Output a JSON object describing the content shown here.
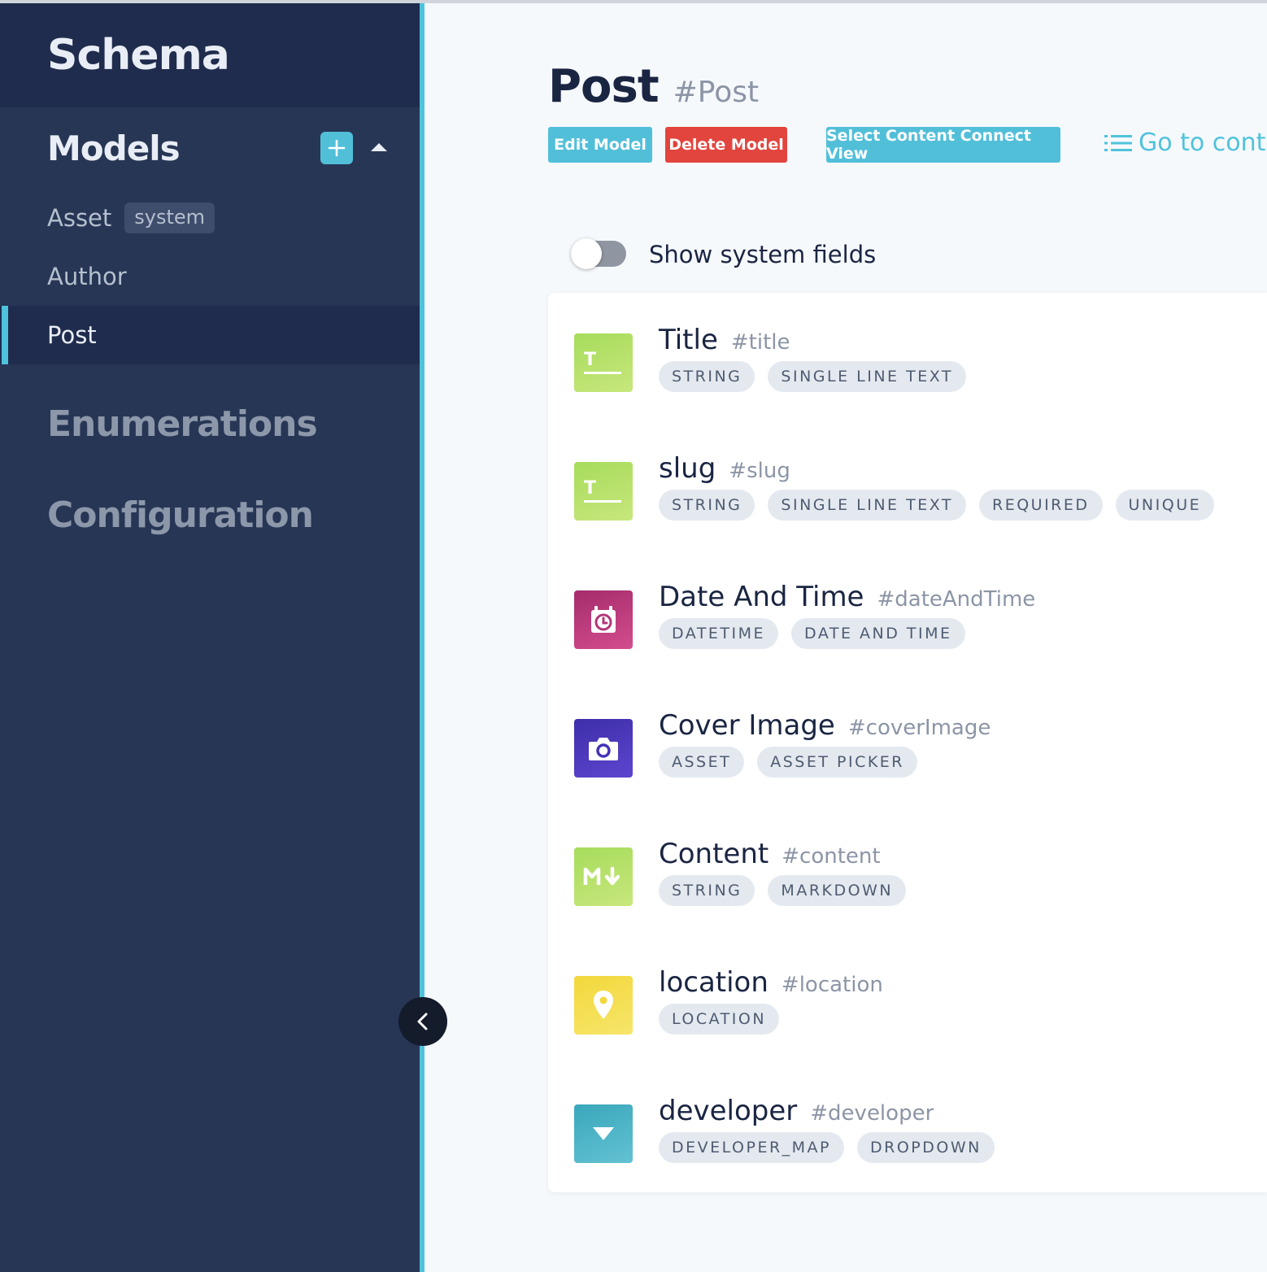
{
  "sidebar": {
    "title": "Schema",
    "models_heading": "Models",
    "models": [
      {
        "label": "Asset",
        "badge": "system"
      },
      {
        "label": "Author"
      },
      {
        "label": "Post",
        "active": true
      }
    ],
    "sections": [
      "Enumerations",
      "Configuration"
    ]
  },
  "model": {
    "name": "Post",
    "api_id": "#Post",
    "buttons": {
      "edit": "Edit Model",
      "delete": "Delete Model",
      "select_view": "Select Content Connect View"
    },
    "goto_label": "Go to conte"
  },
  "toggle": {
    "label": "Show system fields",
    "on": false
  },
  "fields": [
    {
      "name": "Title",
      "api_id": "#title",
      "icon": "text-icon",
      "tags": [
        "STRING",
        "SINGLE LINE TEXT"
      ]
    },
    {
      "name": "slug",
      "api_id": "#slug",
      "icon": "text-icon",
      "tags": [
        "STRING",
        "SINGLE LINE TEXT",
        "REQUIRED",
        "UNIQUE"
      ]
    },
    {
      "name": "Date And Time",
      "api_id": "#dateAndTime",
      "icon": "alarm-clock-icon",
      "tags": [
        "DATETIME",
        "DATE AND TIME"
      ]
    },
    {
      "name": "Cover Image",
      "api_id": "#coverImage",
      "icon": "camera-icon",
      "tags": [
        "ASSET",
        "ASSET PICKER"
      ]
    },
    {
      "name": "Content",
      "api_id": "#content",
      "icon": "markdown-icon",
      "tags": [
        "STRING",
        "MARKDOWN"
      ]
    },
    {
      "name": "location",
      "api_id": "#location",
      "icon": "map-pin-icon",
      "tags": [
        "LOCATION"
      ]
    },
    {
      "name": "developer",
      "api_id": "#developer",
      "icon": "dropdown-icon",
      "tags": [
        "DEVELOPER_MAP",
        "DROPDOWN"
      ]
    }
  ],
  "colors": {
    "sidebar_bg": "#273655",
    "accent": "#52bfd9",
    "danger": "#e2453e",
    "text_icon": "#a6dc5c",
    "datetime_icon": "#a52c6b",
    "asset_icon": "#3e2fa9",
    "location_icon": "#f2d83c",
    "dropdown_icon": "#3aa7bb"
  }
}
